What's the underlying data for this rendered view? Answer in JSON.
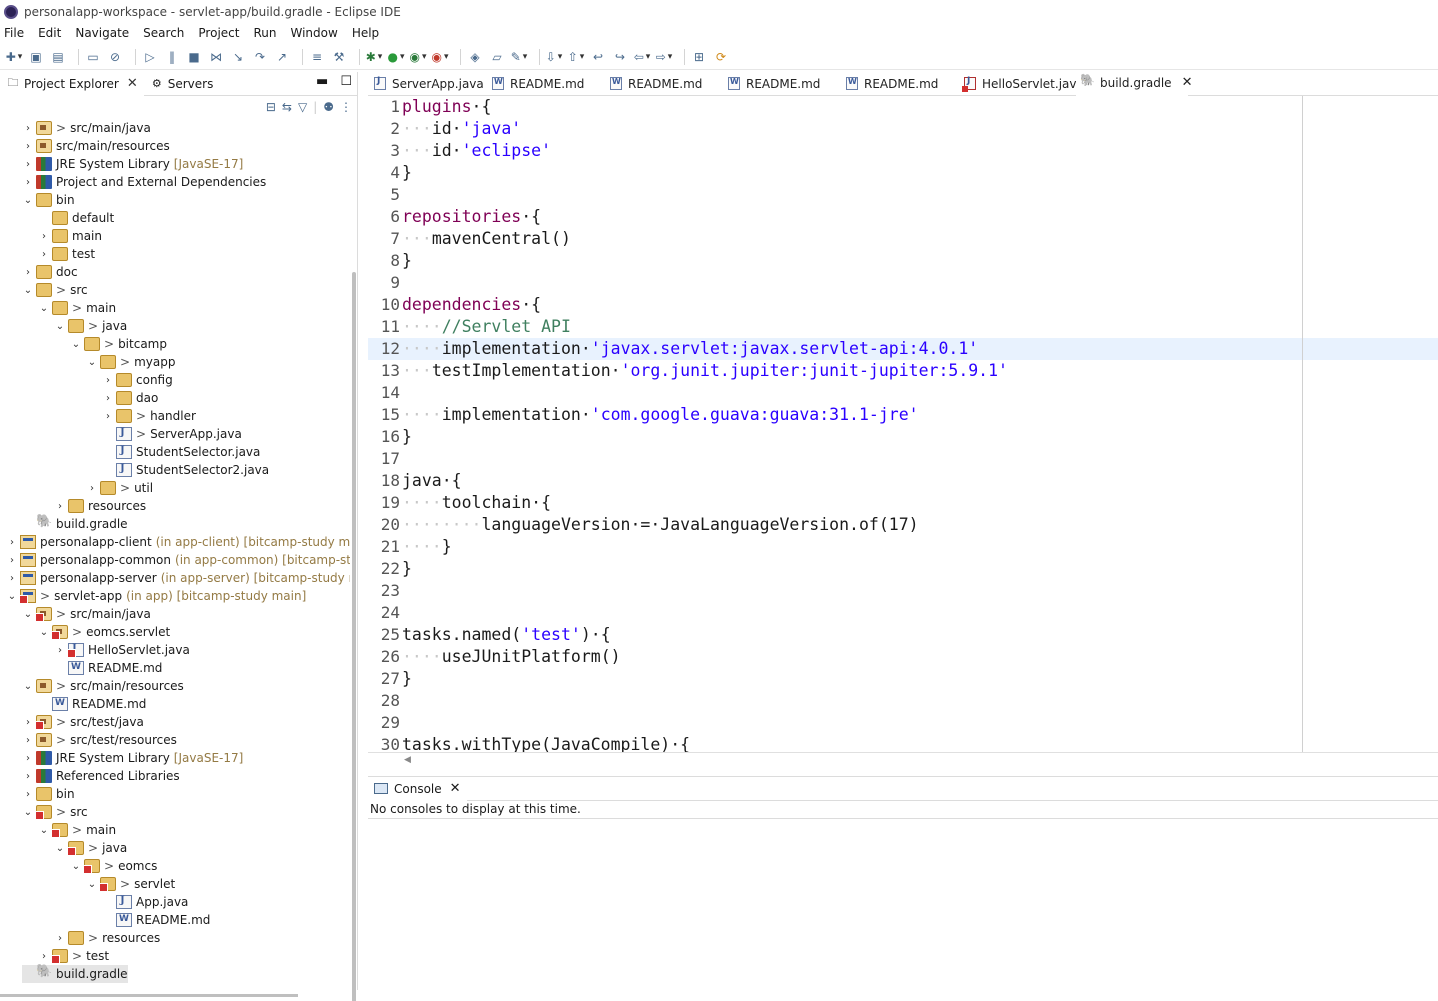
{
  "window": {
    "title": "personalapp-workspace - servlet-app/build.gradle - Eclipse IDE"
  },
  "menu": [
    "File",
    "Edit",
    "Navigate",
    "Search",
    "Project",
    "Run",
    "Window",
    "Help"
  ],
  "left_panel": {
    "tabs": [
      {
        "label": "Project Explorer",
        "active": true
      },
      {
        "label": "Servers",
        "active": false
      }
    ],
    "tree": [
      {
        "indent": 1,
        "tw": ">",
        "icon": "pkg",
        "prefix": ">",
        "label": "src/main/java"
      },
      {
        "indent": 1,
        "tw": ">",
        "icon": "pkg",
        "label": "src/main/resources"
      },
      {
        "indent": 1,
        "tw": ">",
        "icon": "lib",
        "label": "JRE System Library",
        "dec": "[JavaSE-17]"
      },
      {
        "indent": 1,
        "tw": ">",
        "icon": "lib",
        "label": "Project and External Dependencies"
      },
      {
        "indent": 1,
        "tw": "v",
        "icon": "folder",
        "label": "bin"
      },
      {
        "indent": 2,
        "tw": "",
        "icon": "folder",
        "label": "default"
      },
      {
        "indent": 2,
        "tw": ">",
        "icon": "folder",
        "label": "main"
      },
      {
        "indent": 2,
        "tw": ">",
        "icon": "folder",
        "label": "test"
      },
      {
        "indent": 1,
        "tw": ">",
        "icon": "folder",
        "label": "doc"
      },
      {
        "indent": 1,
        "tw": "v",
        "icon": "folder",
        "prefix": ">",
        "label": "src"
      },
      {
        "indent": 2,
        "tw": "v",
        "icon": "folder",
        "prefix": ">",
        "label": "main"
      },
      {
        "indent": 3,
        "tw": "v",
        "icon": "folder",
        "prefix": ">",
        "label": "java"
      },
      {
        "indent": 4,
        "tw": "v",
        "icon": "folder",
        "prefix": ">",
        "label": "bitcamp"
      },
      {
        "indent": 5,
        "tw": "v",
        "icon": "folder",
        "prefix": ">",
        "label": "myapp"
      },
      {
        "indent": 6,
        "tw": ">",
        "icon": "folder",
        "label": "config"
      },
      {
        "indent": 6,
        "tw": ">",
        "icon": "folder",
        "label": "dao"
      },
      {
        "indent": 6,
        "tw": ">",
        "icon": "folder",
        "prefix": ">",
        "label": "handler"
      },
      {
        "indent": 6,
        "tw": "",
        "icon": "java",
        "prefix": ">",
        "label": "ServerApp.java"
      },
      {
        "indent": 6,
        "tw": "",
        "icon": "java",
        "label": "StudentSelector.java"
      },
      {
        "indent": 6,
        "tw": "",
        "icon": "java",
        "label": "StudentSelector2.java"
      },
      {
        "indent": 5,
        "tw": ">",
        "icon": "folder",
        "prefix": ">",
        "label": "util"
      },
      {
        "indent": 3,
        "tw": ">",
        "icon": "folder",
        "label": "resources"
      },
      {
        "indent": 1,
        "tw": "",
        "icon": "gradle",
        "label": "build.gradle"
      },
      {
        "indent": 0,
        "tw": ">",
        "icon": "proj",
        "label": "personalapp-client",
        "dec": "(in app-client) [bitcamp-study main]"
      },
      {
        "indent": 0,
        "tw": ">",
        "icon": "proj",
        "label": "personalapp-common",
        "dec": "(in app-common) [bitcamp-study"
      },
      {
        "indent": 0,
        "tw": ">",
        "icon": "proj",
        "label": "personalapp-server",
        "dec": "(in app-server) [bitcamp-study main]"
      },
      {
        "indent": 0,
        "tw": "v",
        "icon": "proj",
        "err": true,
        "prefix": ">",
        "label": "servlet-app",
        "dec": "(in app) [bitcamp-study main]"
      },
      {
        "indent": 1,
        "tw": "v",
        "icon": "pkg",
        "err": true,
        "prefix": ">",
        "label": "src/main/java"
      },
      {
        "indent": 2,
        "tw": "v",
        "icon": "pkg",
        "err": true,
        "prefix": ">",
        "label": "eomcs.servlet"
      },
      {
        "indent": 3,
        "tw": ">",
        "icon": "java",
        "err": true,
        "label": "HelloServlet.java"
      },
      {
        "indent": 3,
        "tw": "",
        "icon": "md",
        "label": "README.md"
      },
      {
        "indent": 1,
        "tw": "v",
        "icon": "pkg",
        "prefix": ">",
        "label": "src/main/resources"
      },
      {
        "indent": 2,
        "tw": "",
        "icon": "md",
        "label": "README.md"
      },
      {
        "indent": 1,
        "tw": ">",
        "icon": "pkg",
        "err": true,
        "prefix": ">",
        "label": "src/test/java"
      },
      {
        "indent": 1,
        "tw": ">",
        "icon": "pkg",
        "prefix": ">",
        "label": "src/test/resources"
      },
      {
        "indent": 1,
        "tw": ">",
        "icon": "lib",
        "label": "JRE System Library",
        "dec": "[JavaSE-17]"
      },
      {
        "indent": 1,
        "tw": ">",
        "icon": "lib",
        "label": "Referenced Libraries"
      },
      {
        "indent": 1,
        "tw": ">",
        "icon": "folder",
        "label": "bin"
      },
      {
        "indent": 1,
        "tw": "v",
        "icon": "folder",
        "err": true,
        "prefix": ">",
        "label": "src"
      },
      {
        "indent": 2,
        "tw": "v",
        "icon": "folder",
        "err": true,
        "prefix": ">",
        "label": "main"
      },
      {
        "indent": 3,
        "tw": "v",
        "icon": "folder",
        "err": true,
        "prefix": ">",
        "label": "java"
      },
      {
        "indent": 4,
        "tw": "v",
        "icon": "folder",
        "err": true,
        "prefix": ">",
        "label": "eomcs"
      },
      {
        "indent": 5,
        "tw": "v",
        "icon": "folder",
        "err": true,
        "prefix": ">",
        "label": "servlet"
      },
      {
        "indent": 6,
        "tw": "",
        "icon": "java",
        "label": "App.java"
      },
      {
        "indent": 6,
        "tw": "",
        "icon": "md",
        "label": "README.md"
      },
      {
        "indent": 3,
        "tw": ">",
        "icon": "folder",
        "prefix": ">",
        "label": "resources"
      },
      {
        "indent": 2,
        "tw": ">",
        "icon": "folder",
        "err": true,
        "prefix": ">",
        "label": "test"
      },
      {
        "indent": 1,
        "tw": "",
        "icon": "gradle",
        "label": "build.gradle",
        "selected": true
      }
    ]
  },
  "editor": {
    "tabs": [
      {
        "label": "ServerApp.java",
        "icon": "java"
      },
      {
        "label": "README.md",
        "icon": "md"
      },
      {
        "label": "README.md",
        "icon": "md"
      },
      {
        "label": "README.md",
        "icon": "md"
      },
      {
        "label": "README.md",
        "icon": "md"
      },
      {
        "label": "HelloServlet.java",
        "icon": "errj"
      },
      {
        "label": "build.gradle",
        "icon": "gr",
        "active": true
      }
    ],
    "highlighted_line": 12,
    "lines": [
      {
        "n": "1",
        "parts": [
          [
            "kw",
            "plugins"
          ],
          [
            "",
            "·{"
          ]
        ]
      },
      {
        "n": "2",
        "parts": [
          [
            "ws",
            "···"
          ],
          [
            "",
            "id·"
          ],
          [
            "str",
            "'java'"
          ]
        ]
      },
      {
        "n": "3",
        "parts": [
          [
            "ws",
            "···"
          ],
          [
            "",
            "id·"
          ],
          [
            "str",
            "'eclipse'"
          ]
        ]
      },
      {
        "n": "4",
        "parts": [
          [
            "",
            "}"
          ]
        ]
      },
      {
        "n": "5",
        "parts": []
      },
      {
        "n": "6",
        "parts": [
          [
            "kw",
            "repositories"
          ],
          [
            "",
            "·{"
          ]
        ]
      },
      {
        "n": "7",
        "parts": [
          [
            "ws",
            "···"
          ],
          [
            "",
            "mavenCentral()"
          ]
        ]
      },
      {
        "n": "8",
        "parts": [
          [
            "",
            "}"
          ]
        ]
      },
      {
        "n": "9",
        "parts": []
      },
      {
        "n": "10",
        "parts": [
          [
            "kw",
            "dependencies"
          ],
          [
            "",
            "·{"
          ]
        ]
      },
      {
        "n": "11",
        "parts": [
          [
            "ws",
            "····"
          ],
          [
            "cmt",
            "//Servlet API"
          ]
        ]
      },
      {
        "n": "12",
        "parts": [
          [
            "ws",
            "····"
          ],
          [
            "",
            "implementation·"
          ],
          [
            "str",
            "'javax.servlet:javax.servlet-api:4.0.1'"
          ]
        ]
      },
      {
        "n": "13",
        "parts": [
          [
            "ws",
            "···"
          ],
          [
            "",
            "testImplementation·"
          ],
          [
            "str",
            "'org.junit.jupiter:junit-jupiter:5.9.1'"
          ]
        ]
      },
      {
        "n": "14",
        "parts": []
      },
      {
        "n": "15",
        "parts": [
          [
            "ws",
            "····"
          ],
          [
            "",
            "implementation·"
          ],
          [
            "str",
            "'com.google.guava:guava:31.1-jre'"
          ]
        ]
      },
      {
        "n": "16",
        "parts": [
          [
            "",
            "}"
          ]
        ]
      },
      {
        "n": "17",
        "parts": []
      },
      {
        "n": "18",
        "parts": [
          [
            "",
            "java·{"
          ]
        ]
      },
      {
        "n": "19",
        "parts": [
          [
            "ws",
            "····"
          ],
          [
            "",
            "toolchain·{"
          ]
        ]
      },
      {
        "n": "20",
        "parts": [
          [
            "ws",
            "········"
          ],
          [
            "",
            "languageVersion·=·JavaLanguageVersion.of(17)"
          ]
        ]
      },
      {
        "n": "21",
        "parts": [
          [
            "ws",
            "····"
          ],
          [
            "",
            "}"
          ]
        ]
      },
      {
        "n": "22",
        "parts": [
          [
            "",
            "}"
          ]
        ]
      },
      {
        "n": "23",
        "parts": []
      },
      {
        "n": "24",
        "parts": []
      },
      {
        "n": "25",
        "parts": [
          [
            "",
            "tasks.named("
          ],
          [
            "str",
            "'test'"
          ],
          [
            "",
            ")·{"
          ]
        ]
      },
      {
        "n": "26",
        "parts": [
          [
            "ws",
            "····"
          ],
          [
            "",
            "useJUnitPlatform()"
          ]
        ]
      },
      {
        "n": "27",
        "parts": [
          [
            "",
            "}"
          ]
        ]
      },
      {
        "n": "28",
        "parts": []
      },
      {
        "n": "29",
        "parts": []
      },
      {
        "n": "30",
        "parts": [
          [
            "",
            "tasks.withType(JavaCompile)·{"
          ]
        ]
      }
    ]
  },
  "console": {
    "tab_label": "Console",
    "message": "No consoles to display at this time."
  }
}
